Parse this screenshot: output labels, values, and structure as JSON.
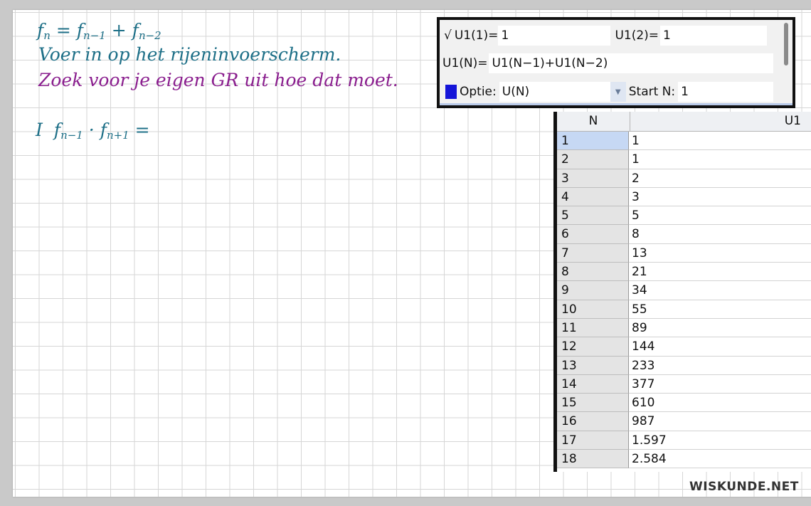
{
  "notes": {
    "line1": {
      "f": "f",
      "n": "n",
      "eq": " = ",
      "f2": "f",
      "n1": "n−1",
      "plus": " + ",
      "f3": "f",
      "n2": "n−2"
    },
    "line2": "Voer in op het rijeninvoerscherm.",
    "line3": "Zoek voor je eigen GR uit hoe dat moet.",
    "line4": {
      "roman": "I",
      "f1": "f",
      "s1": "n−1",
      "dot": " · ",
      "f2": "f",
      "s2": "n+1",
      "eq": " ="
    }
  },
  "editor": {
    "check": "√",
    "u1_1_label": "U1(1)=",
    "u1_1_value": "1",
    "u1_2_label": "U1(2)=",
    "u1_2_value": "1",
    "u1n_label": "U1(N)=",
    "u1n_value": "U1(N−1)+U1(N−2)",
    "option_label": "Optie:",
    "option_value": "U(N)",
    "start_label": "Start N:",
    "start_value": "1",
    "color_swatch": "#1414d8"
  },
  "table": {
    "col_n": "N",
    "col_u": "U1",
    "rows": [
      {
        "n": "1",
        "u": "1"
      },
      {
        "n": "2",
        "u": "1"
      },
      {
        "n": "3",
        "u": "2"
      },
      {
        "n": "4",
        "u": "3"
      },
      {
        "n": "5",
        "u": "5"
      },
      {
        "n": "6",
        "u": "8"
      },
      {
        "n": "7",
        "u": "13"
      },
      {
        "n": "8",
        "u": "21"
      },
      {
        "n": "9",
        "u": "34"
      },
      {
        "n": "10",
        "u": "55"
      },
      {
        "n": "11",
        "u": "89"
      },
      {
        "n": "12",
        "u": "144"
      },
      {
        "n": "13",
        "u": "233"
      },
      {
        "n": "14",
        "u": "377"
      },
      {
        "n": "15",
        "u": "610"
      },
      {
        "n": "16",
        "u": "987"
      },
      {
        "n": "17",
        "u": "1.597"
      },
      {
        "n": "18",
        "u": "2.584"
      }
    ]
  },
  "watermark": "WISKUNDE.NET"
}
